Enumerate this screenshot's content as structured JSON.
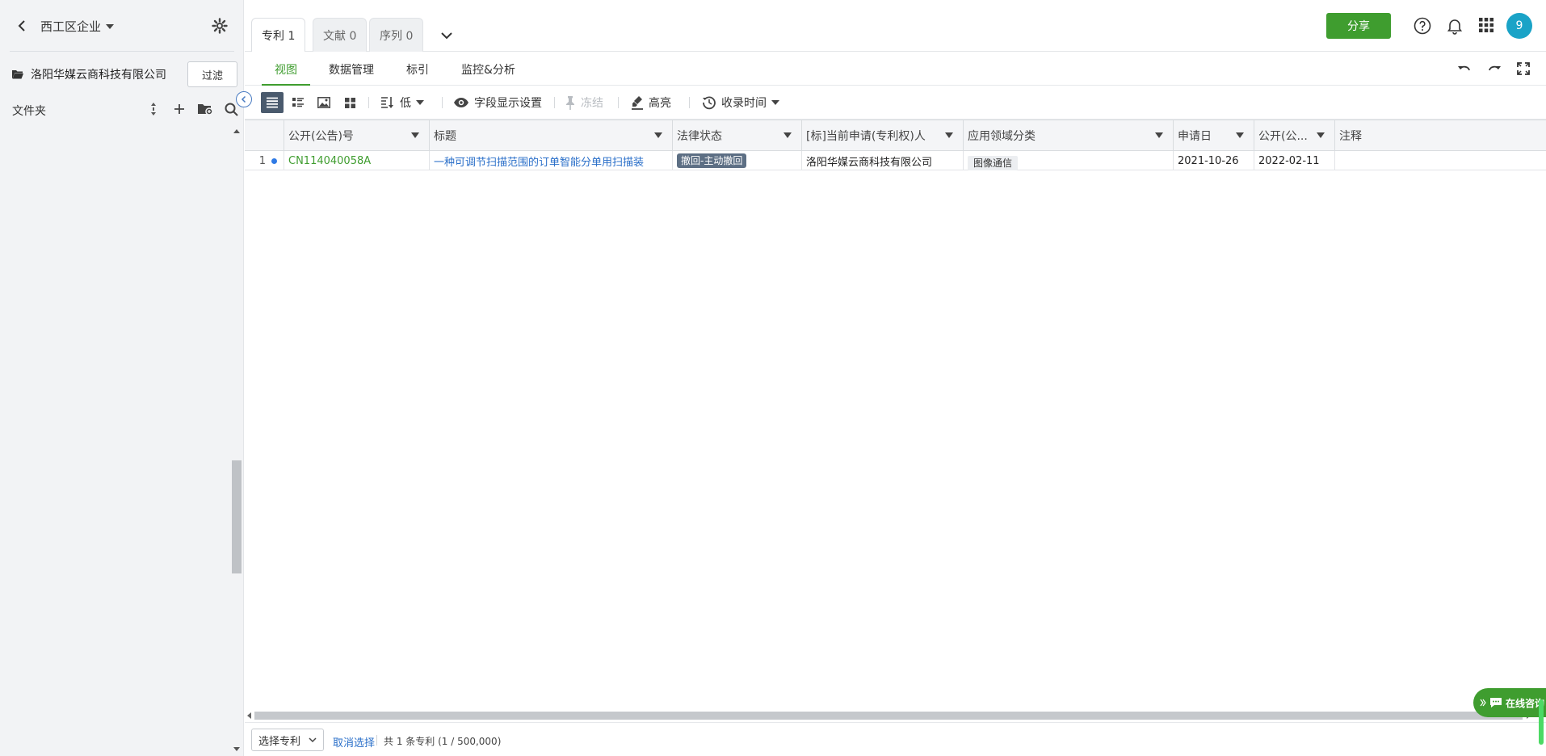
{
  "sidebar": {
    "workspace_title": "西工区企业",
    "company_name": "洛阳华媒云商科技有限公司",
    "filter_label": "过滤",
    "folder_label": "文件夹"
  },
  "tabs": [
    {
      "label": "专利 1",
      "active": true
    },
    {
      "label": "文献 0",
      "active": false
    },
    {
      "label": "序列 0",
      "active": false
    }
  ],
  "topbar": {
    "share_label": "分享",
    "avatar_text": "9",
    "accent_color": "#3f9d2f"
  },
  "subnav": {
    "tabs": [
      "视图",
      "数据管理",
      "标引",
      "监控&分析"
    ],
    "active": "视图"
  },
  "toolbar": {
    "sort_level": "低",
    "field_settings": "字段显示设置",
    "freeze": "冻结",
    "highlight": "高亮",
    "collect_time": "收录时间"
  },
  "table": {
    "columns": [
      "公开(公告)号",
      "标题",
      "法律状态",
      "[标]当前申请(专利权)人",
      "应用领域分类",
      "申请日",
      "公开(公...",
      "注释"
    ],
    "rows": [
      {
        "index": "1",
        "pub_no": "CN114040058A",
        "title": "一种可调节扫描范围的订单智能分单用扫描装",
        "legal_status": "撤回-主动撤回",
        "applicant": "洛阳华媒云商科技有限公司",
        "field": "图像通信",
        "apply_date": "2021-10-26",
        "pub_date": "2022-02-11",
        "note": ""
      }
    ]
  },
  "footer": {
    "select_label": "选择专利",
    "cancel_label": "取消选择",
    "count_text": "共 1 条专利 (1 / 500,000)"
  },
  "chat": {
    "label": "在线咨询"
  }
}
